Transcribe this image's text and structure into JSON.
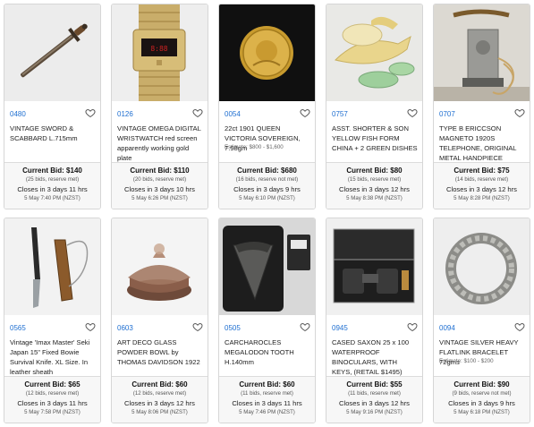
{
  "lots": [
    {
      "number": "0480",
      "title": "VINTAGE SWORD & SCABBARD L.715mm",
      "estimate": "",
      "current_bid": "Current Bid: $140",
      "bids": "(25 bids, reserve met)",
      "closes": "Closes in 3 days 11 hrs",
      "close_date": "5 May 7:40 PM (NZST)",
      "image_icon": "sword-image"
    },
    {
      "number": "0126",
      "title": "VINTAGE OMEGA DIGITAL WRISTWATCH red screen apparently working gold plate",
      "estimate": "",
      "current_bid": "Current Bid: $110",
      "bids": "(20 bids, reserve met)",
      "closes": "Closes in 3 days 10 hrs",
      "close_date": "5 May 6:26 PM (NZST)",
      "image_icon": "wristwatch-image"
    },
    {
      "number": "0054",
      "title": "22ct 1901 QUEEN VICTORIA SOVEREIGN, 7.98gm",
      "estimate": "Estimate: $800 - $1,600",
      "current_bid": "Current Bid: $680",
      "bids": "(16 bids, reserve not met)",
      "closes": "Closes in 3 days 9 hrs",
      "close_date": "5 May 6:10 PM (NZST)",
      "image_icon": "gold-coin-image"
    },
    {
      "number": "0757",
      "title": "ASST. SHORTER & SON YELLOW FISH FORM CHINA + 2 GREEN DISHES",
      "estimate": "",
      "current_bid": "Current Bid: $80",
      "bids": "(15 bids, reserve met)",
      "closes": "Closes in 3 days 12 hrs",
      "close_date": "5 May 8:38 PM (NZST)",
      "image_icon": "china-dishes-image"
    },
    {
      "number": "0707",
      "title": "TYPE B ERICCSON MAGNETO 1920S TELEPHONE, ORIGINAL METAL HANDPIECE",
      "estimate": "",
      "current_bid": "Current Bid: $75",
      "bids": "(14 bids, reserve met)",
      "closes": "Closes in 3 days 12 hrs",
      "close_date": "5 May 8:28 PM (NZST)",
      "image_icon": "telephone-image"
    },
    {
      "number": "0565",
      "title": "Vintage 'Imax Master' Seki Japan 15\" Fixed Bowie Survival Knife. XL Size. In leather sheath",
      "estimate": "",
      "current_bid": "Current Bid: $65",
      "bids": "(12 bids, reserve met)",
      "closes": "Closes in 3 days 11 hrs",
      "close_date": "5 May 7:58 PM (NZST)",
      "image_icon": "knife-image"
    },
    {
      "number": "0603",
      "title": "ART DECO GLASS POWDER BOWL by THOMAS DAVIDSON 1922",
      "estimate": "",
      "current_bid": "Current Bid: $60",
      "bids": "(12 bids, reserve met)",
      "closes": "Closes in 3 days 12 hrs",
      "close_date": "5 May 8:06 PM (NZST)",
      "image_icon": "glass-bowl-image"
    },
    {
      "number": "0505",
      "title": "CARCHAROCLES MEGALODON TOOTH H.140mm",
      "estimate": "",
      "current_bid": "Current Bid: $60",
      "bids": "(11 bids, reserve met)",
      "closes": "Closes in 3 days 11 hrs",
      "close_date": "5 May 7:46 PM (NZST)",
      "image_icon": "megalodon-tooth-image"
    },
    {
      "number": "0945",
      "title": "CASED SAXON 25 x 100 WATERPROOF BINOCULARS, WITH KEYS, (RETAIL $1495)",
      "estimate": "",
      "current_bid": "Current Bid: $55",
      "bids": "(11 bids, reserve met)",
      "closes": "Closes in 3 days 12 hrs",
      "close_date": "5 May 9:16 PM (NZST)",
      "image_icon": "binoculars-case-image"
    },
    {
      "number": "0094",
      "title": "VINTAGE SILVER HEAVY FLATLINK BRACELET 72gms",
      "estimate": "Estimate: $100 - $200",
      "current_bid": "Current Bid: $90",
      "bids": "(9 bids, reserve not met)",
      "closes": "Closes in 3 days 9 hrs",
      "close_date": "5 May 6:18 PM (NZST)",
      "image_icon": "bracelet-image"
    }
  ],
  "colors": {
    "lot_link": "#1f6fd1",
    "card_border": "#d6d6d6",
    "bid_panel": "#f7f7f7"
  },
  "icons": {
    "favourite": "heart-outline-icon"
  }
}
